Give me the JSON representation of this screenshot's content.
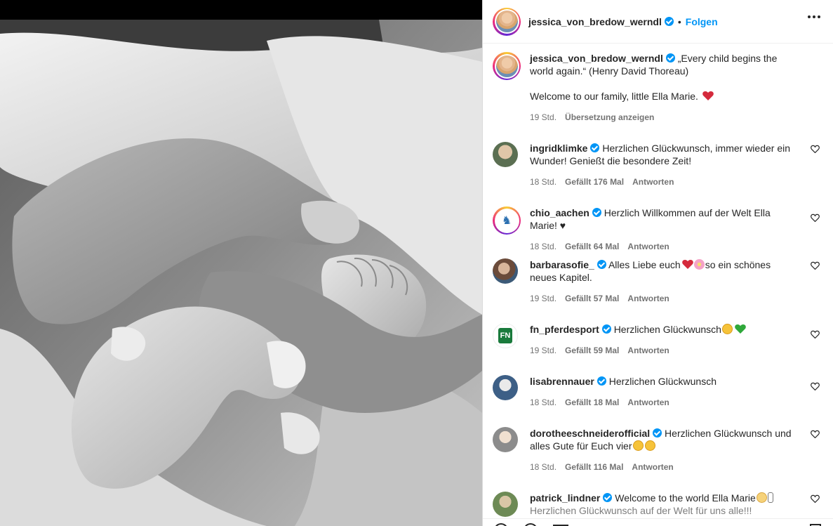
{
  "post": {
    "username": "jessica_von_bredow_werndl",
    "dot": "•",
    "follow_label": "Folgen",
    "caption": "„Every child begins the world again.“ (Henry David Thoreau)",
    "caption_line2": "Welcome to our family, little Ella Marie.",
    "caption_time": "19 Std.",
    "translate_label": "Übersetzung anzeigen"
  },
  "comments": [
    {
      "user": "ingridklimke",
      "text": "Herzlichen Glückwunsch, immer wieder ein Wunder! Genießt die besondere Zeit!",
      "time": "18 Std.",
      "likes": "Gefällt 176 Mal",
      "reply": "Antworten"
    },
    {
      "user": "chio_aachen",
      "text": "Herzlich Willkommen auf der Welt Ella Marie! ♥",
      "time": "18 Std.",
      "likes": "Gefällt 64 Mal",
      "reply": "Antworten"
    },
    {
      "user": "barbarasofie_",
      "text_a": "Alles Liebe euch",
      "text_b": "so ein schönes neues Kapitel.",
      "time": "19 Std.",
      "likes": "Gefällt 57 Mal",
      "reply": "Antworten"
    },
    {
      "user": "fn_pferdesport",
      "text": "Herzlichen Glückwunsch",
      "time": "19 Std.",
      "likes": "Gefällt 59 Mal",
      "reply": "Antworten"
    },
    {
      "user": "lisabrennauer",
      "text": "Herzlichen Glückwunsch",
      "time": "18 Std.",
      "likes": "Gefällt 18 Mal",
      "reply": "Antworten"
    },
    {
      "user": "dorotheeschneiderofficial",
      "text": "Herzlichen Glückwunsch und alles Gute für Euch vier",
      "time": "18 Std.",
      "likes": "Gefällt 116 Mal",
      "reply": "Antworten"
    },
    {
      "user": "patrick_lindner",
      "text": "Welcome to the world Ella Marie",
      "text2": "Herzlichen Glückwunsch auf der Welt für uns alle!!!"
    }
  ],
  "icons": [
    "more-icon",
    "heart-icon",
    "verified-icon",
    "comment-icon",
    "share-icon",
    "bookmark-icon"
  ],
  "colors": {
    "accent": "#0095f6",
    "text": "#262626",
    "muted": "#737373",
    "red_heart": "#ed4956"
  }
}
